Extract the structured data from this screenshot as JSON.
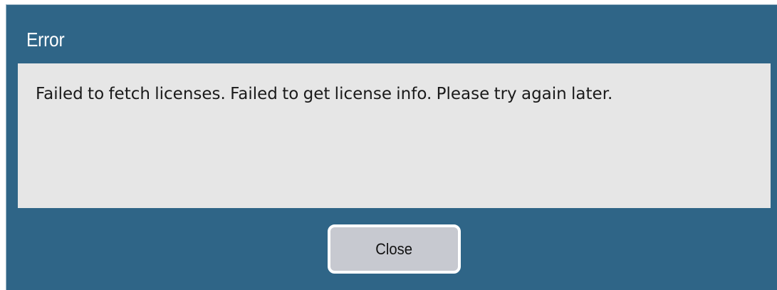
{
  "dialog": {
    "title": "Error",
    "message": "Failed to fetch licenses. Failed to get license info. Please try again later.",
    "close_label": "Close"
  },
  "colors": {
    "dialog_background": "#2f6587",
    "message_background": "#e6e6e6",
    "button_background": "#c7c9d0",
    "button_border": "#ffffff"
  }
}
